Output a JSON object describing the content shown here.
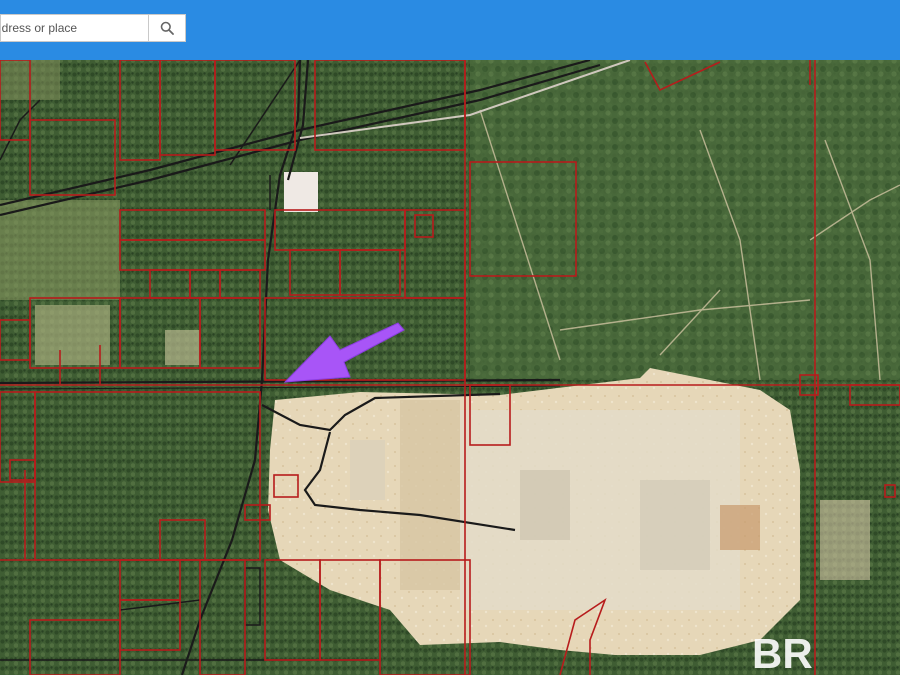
{
  "search": {
    "placeholder": "ddress or place",
    "icon": "search-icon"
  },
  "map": {
    "imagery": "aerial",
    "parcel_color": "#b71c1c",
    "road_color": "#1a1a1a",
    "marker": {
      "icon": "arrow-icon",
      "color": "#a855f7"
    },
    "watermark": "BR"
  },
  "colors": {
    "topbar": "#2a8be3",
    "forest": "#3f5e33",
    "cleared": "#e2d3b3"
  }
}
